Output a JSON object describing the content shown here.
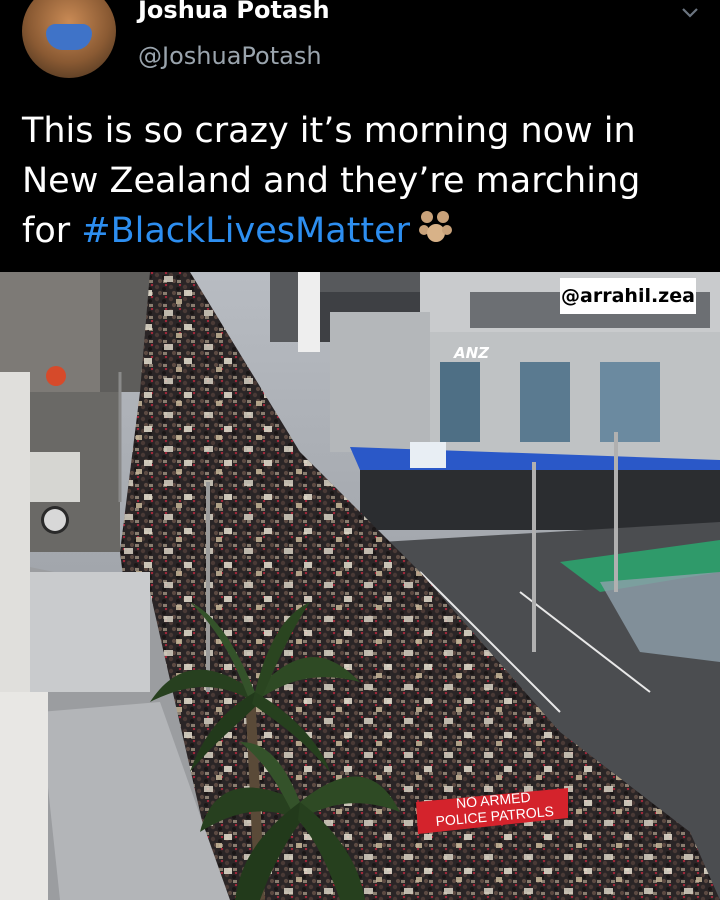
{
  "tweet": {
    "display_name": "Joshua Potash",
    "handle": "@JoshuaPotash",
    "text_line1": "This is so crazy it’s morning now in",
    "text_line2": "New Zealand and they’re marching",
    "text_line3_prefix": "for ",
    "hashtag": "#BlackLivesMatter",
    "hashtag_color": "#2d8ef0",
    "emoji_icon": "paw-prints-icon"
  },
  "photo": {
    "watermark": "@arrahil.zea",
    "bank_sign": "ANZ",
    "banner_line1": "NO ARMED",
    "banner_line2": "POLICE PATROLS",
    "banner_color": "#d4232c"
  }
}
